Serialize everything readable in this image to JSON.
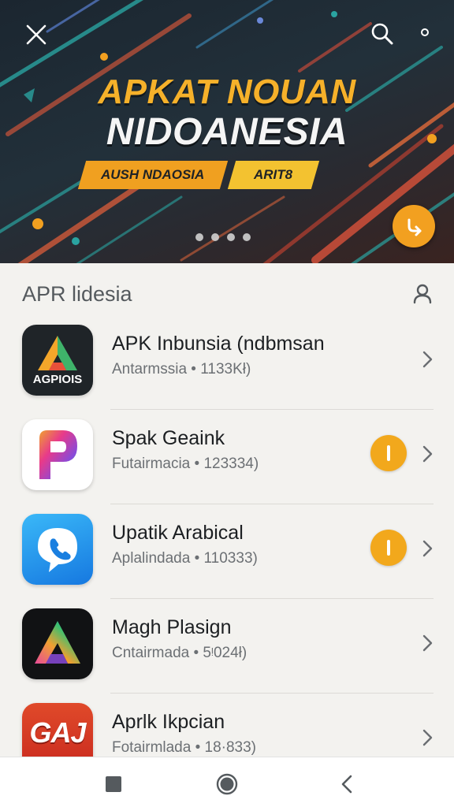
{
  "banner": {
    "title_line1": "APKAT NOUAN",
    "title_line2": "NIDOANESIA",
    "tag_primary": "AUSH NDAOSIA",
    "tag_secondary": "ARIT8",
    "carousel_dots": 4,
    "icons": {
      "close": "close-icon",
      "search": "search-icon",
      "more": "more-icon",
      "fab": "return-arrow-icon"
    }
  },
  "section": {
    "title": "APR lidesia",
    "icon": "user-icon"
  },
  "apps": [
    {
      "name": "APK Inbunsia (ndbmsan",
      "meta": "Antarmssia • 1133Kł)",
      "icon_text": "AGPIOIS",
      "badge": false
    },
    {
      "name": "Spak Geaink",
      "meta": "Futairmacia • 123334)",
      "icon_text": "",
      "badge": true
    },
    {
      "name": "Upatik Arabical",
      "meta": "Aplalindada • 110333)",
      "icon_text": "",
      "badge": true
    },
    {
      "name": "Magh Plasign",
      "meta": "Cntairmada • 5ᵎ024ł)",
      "icon_text": "",
      "badge": false
    },
    {
      "name": "Aprlk Ikpcian",
      "meta": "Fotairmlada • 18·833)",
      "icon_text": "GAJ",
      "badge": false
    }
  ],
  "colors": {
    "accent": "#f2a81c",
    "banner_dark": "#22303a",
    "tag_primary": "#f0a020",
    "tag_secondary": "#f3c230"
  },
  "navbar": {
    "icons": [
      "stop-square-icon",
      "home-circle-icon",
      "back-chevron-icon"
    ]
  }
}
